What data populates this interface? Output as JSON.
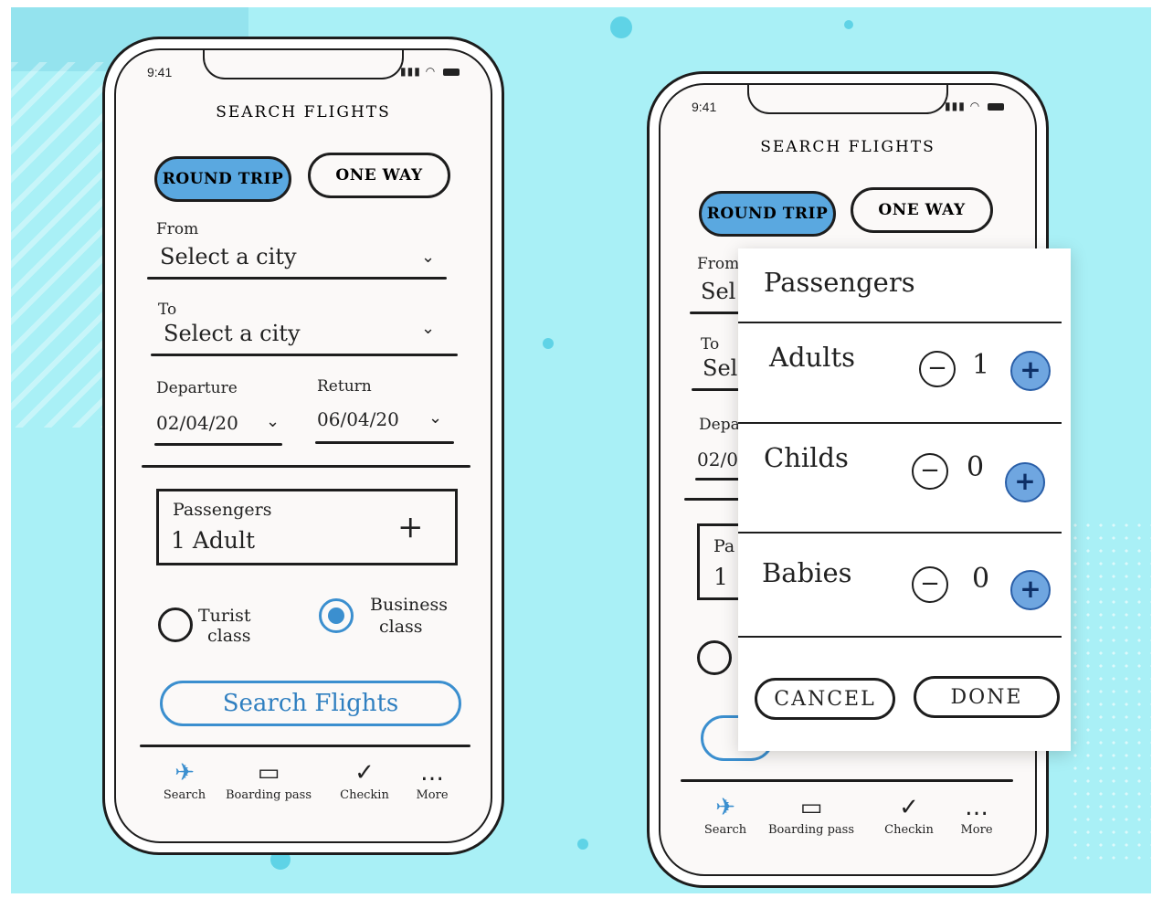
{
  "status_bar": {
    "time": "9:41"
  },
  "screen": {
    "title": "SEARCH FLIGHTS",
    "trip_types": [
      {
        "label": "ROUND TRIP",
        "selected": true
      },
      {
        "label": "ONE WAY",
        "selected": false
      }
    ],
    "from": {
      "label": "From",
      "value": "Select a city"
    },
    "to": {
      "label": "To",
      "value": "Select a city"
    },
    "departure": {
      "label": "Departure",
      "value": "02/04/20"
    },
    "return": {
      "label": "Return",
      "value": "06/04/20"
    },
    "passengers": {
      "label": "Passengers",
      "value": "1 Adult",
      "add_symbol": "+"
    },
    "classes": [
      {
        "label_line1": "Turist",
        "label_line2": "class",
        "selected": false
      },
      {
        "label_line1": "Business",
        "label_line2": "class",
        "selected": true
      }
    ],
    "search_button": "Search Flights",
    "tabs": [
      {
        "icon": "airplane-icon",
        "label": "Search"
      },
      {
        "icon": "ticket-icon",
        "label": "Boarding pass"
      },
      {
        "icon": "checkmark-icon",
        "label": "Checkin"
      },
      {
        "icon": "more-icon",
        "label": "More"
      }
    ]
  },
  "partial": {
    "from_label": "From",
    "from_value": "Sel",
    "to_label": "To",
    "to_value": "Sel",
    "departure_label": "Depa",
    "departure_value": "02/0",
    "passengers_label": "Pa",
    "passengers_value": "1"
  },
  "modal": {
    "title": "Passengers",
    "rows": [
      {
        "label": "Adults",
        "count": "1",
        "minus": "−",
        "plus": "+"
      },
      {
        "label": "Childs",
        "count": "0",
        "minus": "−",
        "plus": "+"
      },
      {
        "label": "Babies",
        "count": "0",
        "minus": "−",
        "plus": "+"
      }
    ],
    "cancel": "CANCEL",
    "done": "DONE"
  },
  "colors": {
    "background": "#a9f0f6",
    "accent": "#5aa8e0",
    "accent_stroke": "#3b8fcf"
  }
}
